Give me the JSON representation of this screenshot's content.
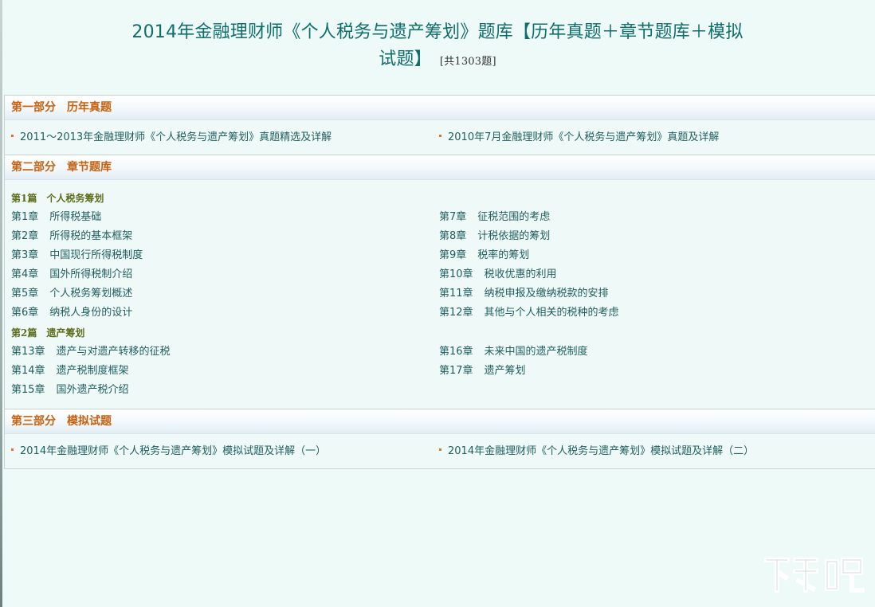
{
  "title": {
    "line1": "2014年金融理财师《个人税务与遗产筹划》题库【历年真题＋章节题库＋模拟",
    "line2": "试题】",
    "count": "[共1303题]"
  },
  "part1": {
    "heading": "第一部分　历年真题",
    "links": [
      "2011～2013年金融理财师《个人税务与遗产筹划》真题精选及详解",
      "2010年7月金融理财师《个人税务与遗产筹划》真题及详解"
    ]
  },
  "part2": {
    "heading": "第二部分　章节题库",
    "sections": [
      {
        "title": "第1篇　个人税务筹划",
        "chapters": [
          {
            "num": "第1章",
            "name": "所得税基础"
          },
          {
            "num": "第2章",
            "name": "所得税的基本框架"
          },
          {
            "num": "第3章",
            "name": "中国现行所得税制度"
          },
          {
            "num": "第4章",
            "name": "国外所得税制介绍"
          },
          {
            "num": "第5章",
            "name": "个人税务筹划概述"
          },
          {
            "num": "第6章",
            "name": "纳税人身份的设计"
          },
          {
            "num": "第7章",
            "name": "征税范围的考虑"
          },
          {
            "num": "第8章",
            "name": "计税依据的筹划"
          },
          {
            "num": "第9章",
            "name": "税率的筹划"
          },
          {
            "num": "第10章",
            "name": "税收优惠的利用"
          },
          {
            "num": "第11章",
            "name": "纳税申报及缴纳税款的安排"
          },
          {
            "num": "第12章",
            "name": "其他与个人相关的税种的考虑"
          }
        ]
      },
      {
        "title": "第2篇　遗产筹划",
        "chapters": [
          {
            "num": "第13章",
            "name": "遗产与对遗产转移的征税"
          },
          {
            "num": "第14章",
            "name": "遗产税制度框架"
          },
          {
            "num": "第15章",
            "name": "国外遗产税介绍"
          },
          {
            "num": "第16章",
            "name": "未来中国的遗产税制度"
          },
          {
            "num": "第17章",
            "name": "遗产筹划"
          }
        ]
      }
    ]
  },
  "part3": {
    "heading": "第三部分　模拟试题",
    "links": [
      "2014年金融理财师《个人税务与遗产筹划》模拟试题及详解（一）",
      "2014年金融理财师《个人税务与遗产筹划》模拟试题及详解（二）"
    ]
  },
  "colors": {
    "background": "#eefaf8",
    "title": "#0f6e6b",
    "heading": "#c8600e",
    "subheading": "#5c6d1b",
    "link": "#1e5e5e",
    "bullet": "#e0722a"
  },
  "icons": {
    "bullet": "square-bullet-icon",
    "watermark": "xiazaiba-logo"
  }
}
